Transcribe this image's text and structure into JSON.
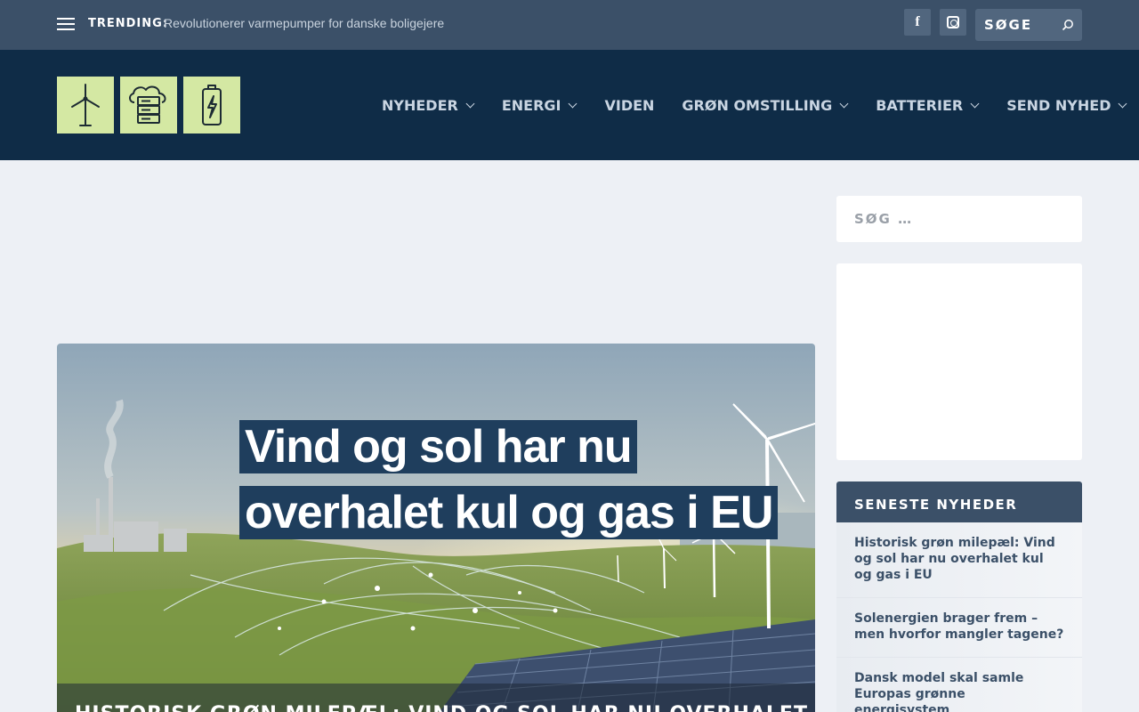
{
  "topbar": {
    "trending_label": "TRENDING:",
    "trending_text": "Revolutionerer varmepumper for danske boligejere",
    "social": {
      "facebook_glyph": "f",
      "facebook_icon": "facebook-icon",
      "instagram_icon": "instagram-icon"
    },
    "search_placeholder": "SØGE",
    "search_icon": "search-icon"
  },
  "header": {
    "logo_icons": [
      "wind-turbine-icon",
      "cloud-server-icon",
      "battery-charging-icon"
    ],
    "nav": [
      {
        "label": "NYHEDER",
        "has_dropdown": true
      },
      {
        "label": "ENERGI",
        "has_dropdown": true
      },
      {
        "label": "VIDEN",
        "has_dropdown": false
      },
      {
        "label": "GRØN OMSTILLING",
        "has_dropdown": true
      },
      {
        "label": "BATTERIER",
        "has_dropdown": true
      },
      {
        "label": "SEND NYHED",
        "has_dropdown": true
      }
    ]
  },
  "feature": {
    "image_title_line1": "Vind og sol har nu",
    "image_title_line2": "overhalet kul og gas i EU",
    "caption": "HISTORISK GRØN MILEPÆL: VIND OG SOL HAR NU OVERHALET KUL OG"
  },
  "sidebar": {
    "search_placeholder": "SØG …",
    "latest_title": "SENESTE NYHEDER",
    "latest_items": [
      "Historisk grøn milepæl: Vind og sol har nu overhalet kul og gas i EU",
      "Solenergien brager frem – men hvorfor mangler tagene?",
      "Dansk model skal samle Europas grønne energisystem"
    ]
  },
  "colors": {
    "topbar": "#3b5068",
    "header": "#0f2c47",
    "page_bg": "#edf0f5",
    "logo_tile": "#d4e8a3",
    "nav_text": "#c9d5e2"
  }
}
